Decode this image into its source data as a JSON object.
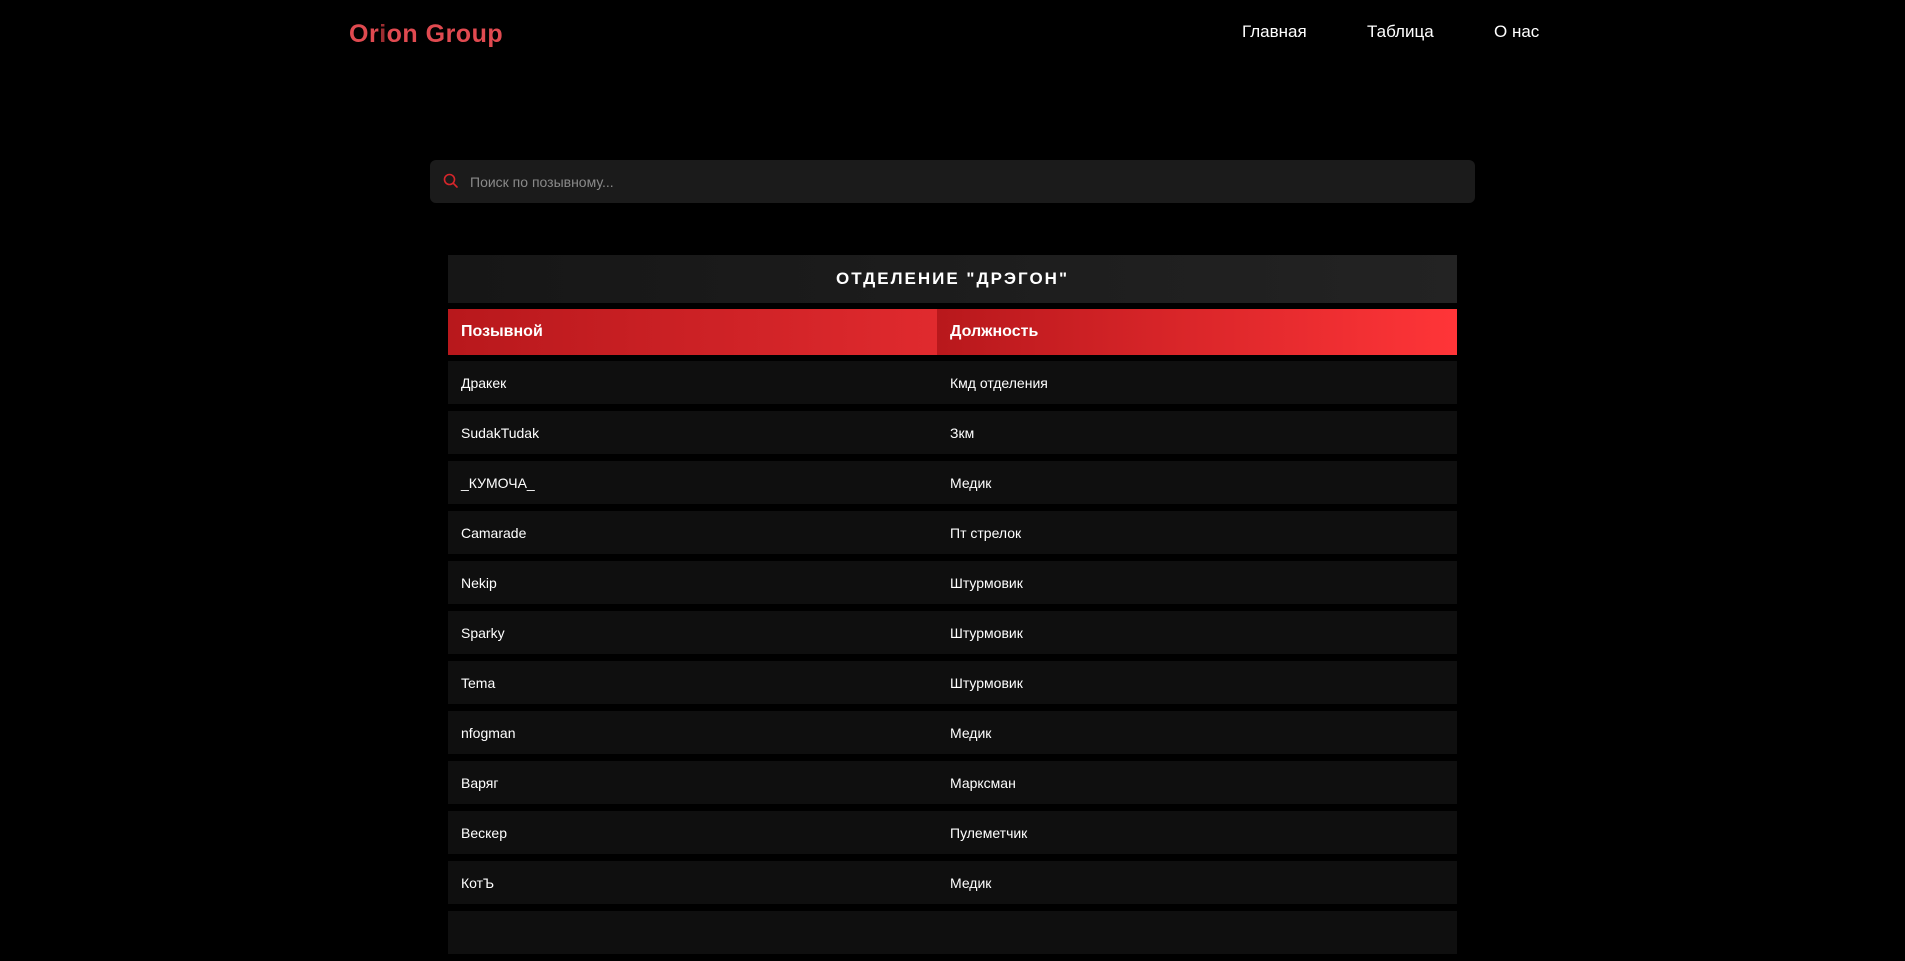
{
  "header": {
    "logo_part1": "Or",
    "logo_part2": "i",
    "logo_part3": "on Group",
    "nav": [
      {
        "label": "Главная"
      },
      {
        "label": "Таблица"
      },
      {
        "label": "О нас"
      }
    ]
  },
  "search": {
    "placeholder": "Поиск по позывному...",
    "value": "",
    "icon": "search-icon"
  },
  "section": {
    "title": "ОТДЕЛЕНИЕ \"ДРЭГОН\"",
    "columns": [
      "Позывной",
      "Должность"
    ],
    "rows": [
      [
        "Дракек",
        "Кмд отделения"
      ],
      [
        "SudakTudak",
        "Зкм"
      ],
      [
        "_КУМОЧА_",
        "Медик"
      ],
      [
        "Camarade",
        "Пт стрелок"
      ],
      [
        "Nekip",
        "Штурмовик"
      ],
      [
        "Sparky",
        "Штурмовик"
      ],
      [
        "Tema",
        "Штурмовик"
      ],
      [
        "nfogman",
        "Медик"
      ],
      [
        "Варяг",
        "Марксман"
      ],
      [
        "Вескер",
        "Пулеметчик"
      ],
      [
        "КотЪ",
        "Медик"
      ]
    ]
  },
  "colors": {
    "accent": "#e02a2e",
    "logo": "#e04a50",
    "background": "#000000",
    "row_bg": "#0f0f0f"
  }
}
